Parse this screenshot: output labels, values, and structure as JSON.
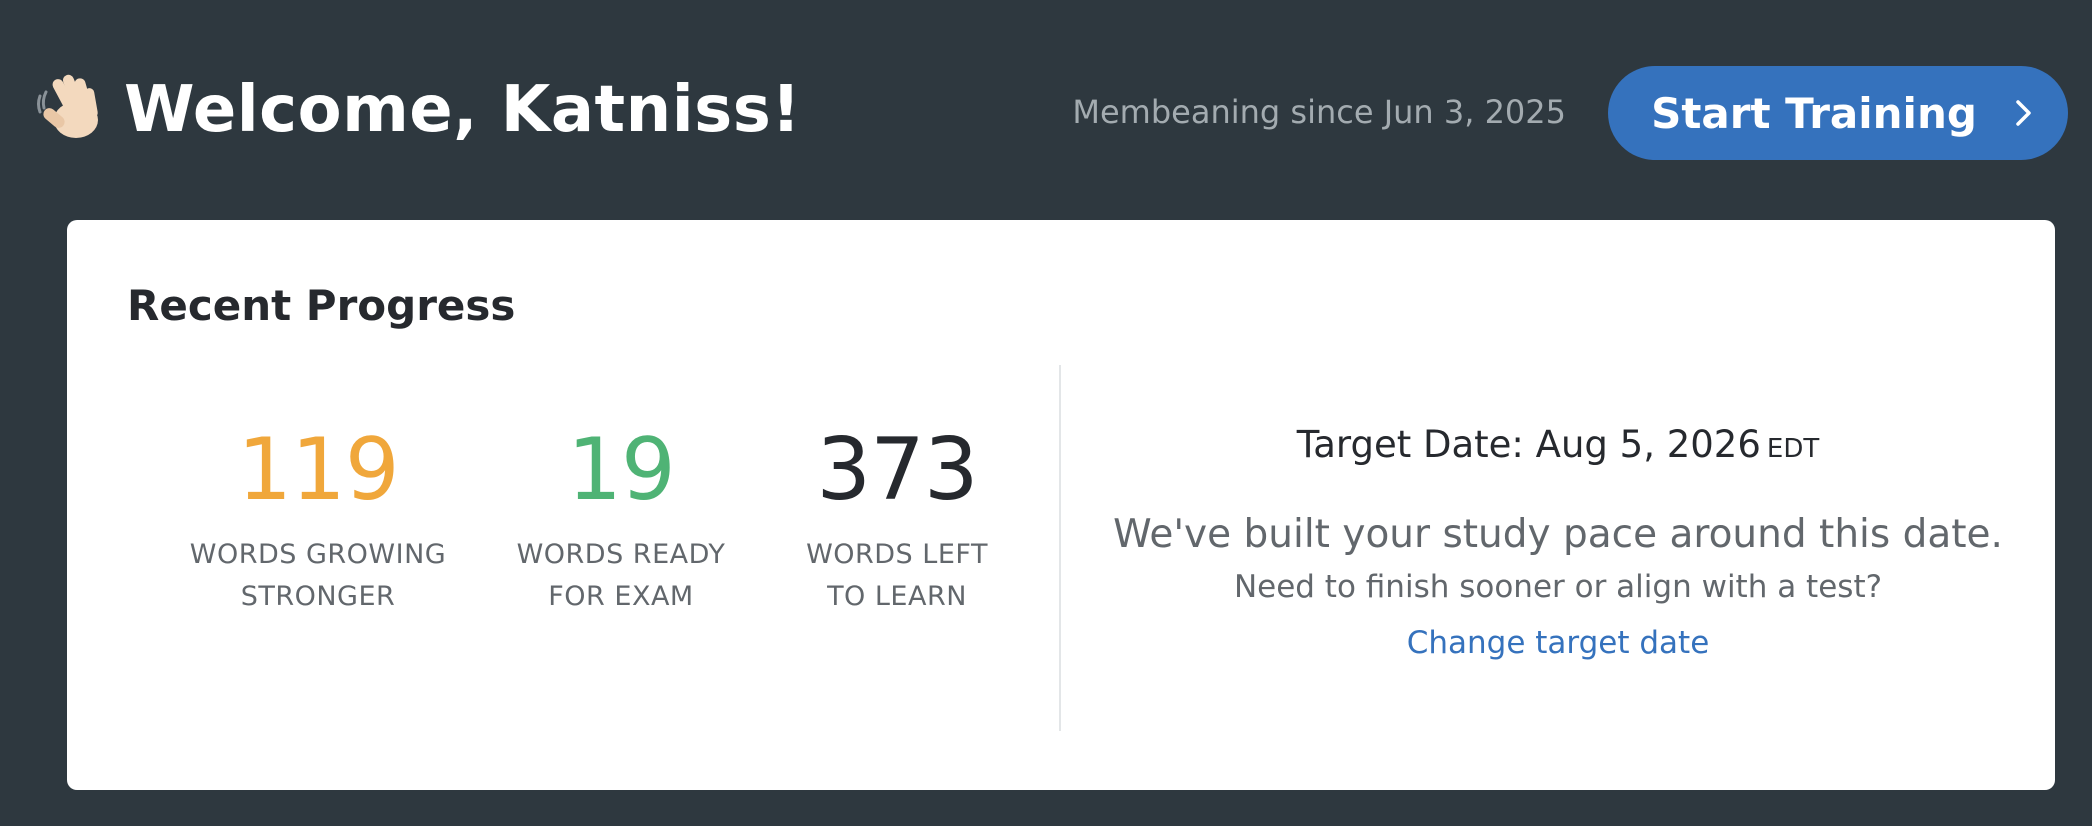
{
  "header": {
    "wave_icon": "waving-hand-emoji",
    "welcome_title": "Welcome, Katniss!",
    "member_since": "Membeaning since Jun 3, 2025",
    "start_training_label": "Start Training",
    "start_training_icon": "chevron-right"
  },
  "progress": {
    "title": "Recent Progress",
    "stats": [
      {
        "value": "119",
        "label_line1": "WORDS GROWING",
        "label_line2": "STRONGER",
        "color": "#f0a73b"
      },
      {
        "value": "19",
        "label_line1": "WORDS READY",
        "label_line2": "FOR EXAM",
        "color": "#4fb375"
      },
      {
        "value": "373",
        "label_line1": "WORDS LEFT",
        "label_line2": "TO LEARN",
        "color": "#26292e"
      }
    ],
    "target": {
      "label": "Target Date: Aug 5, 2026",
      "timezone": "EDT",
      "pace_text": "We've built your study pace around this date.",
      "sooner_text": "Need to finish sooner or align with a test?",
      "change_link": "Change target date"
    }
  },
  "colors": {
    "background": "#2e383f",
    "accent_blue": "#3572bd",
    "growing_orange": "#f0a73b",
    "ready_green": "#4fb375"
  }
}
